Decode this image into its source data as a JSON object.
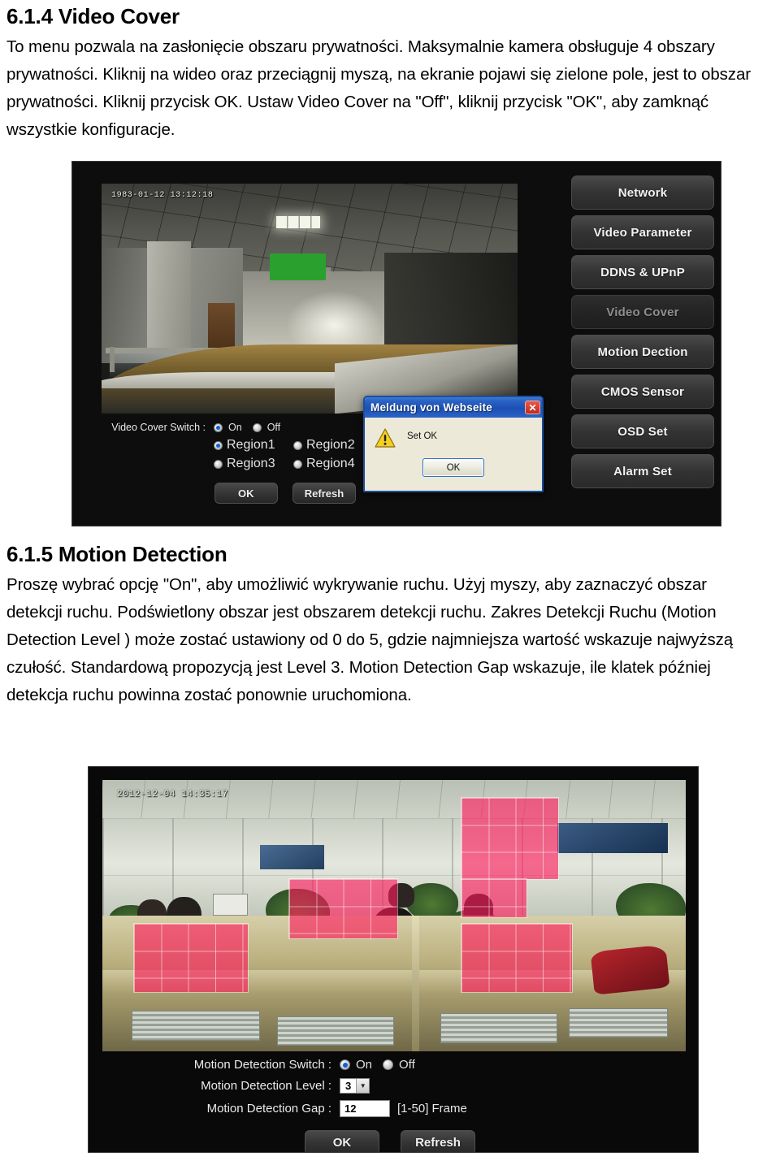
{
  "section1": {
    "heading": "6.1.4 Video Cover",
    "paragraphs": [
      "To menu pozwala na zasłonięcie obszaru prywatności. Maksymalnie kamera obsługuje 4 obszary prywatności. Kliknij na wideo oraz przeciągnij myszą, na ekranie pojawi się zielone pole, jest to obszar prywatności. Kliknij przycisk OK. Ustaw Video Cover na \"Off\", kliknij przycisk \"OK\", aby zamknąć wszystkie konfiguracje."
    ]
  },
  "section2": {
    "heading": "6.1.5 Motion Detection",
    "paragraphs": [
      "Proszę wybrać opcję \"On\", aby umożliwić wykrywanie ruchu. Użyj myszy, aby zaznaczyć obszar detekcji ruchu. Podświetlony obszar jest obszarem detekcji ruchu. Zakres Detekcji Ruchu (Motion Detection Level ) może zostać ustawiony od 0 do 5, gdzie najmniejsza wartość wskazuje najwyższą czułość. Standardową propozycją jest Level 3. Motion Detection Gap wskazuje, ile klatek później detekcja ruchu powinna zostać ponownie uruchomiona."
    ]
  },
  "screenshot1": {
    "timestamp": "1983-01-12 13:12:18",
    "dialog": {
      "title": "Meldung von Webseite",
      "close_label": "✕",
      "message": "Set OK",
      "ok_label": "OK",
      "warning_icon": "warning-triangle-icon"
    },
    "menu": [
      {
        "label": "Network",
        "active": false
      },
      {
        "label": "Video Parameter",
        "active": false
      },
      {
        "label": "DDNS & UPnP",
        "active": false
      },
      {
        "label": "Video Cover",
        "active": true
      },
      {
        "label": "Motion Dection",
        "active": false
      },
      {
        "label": "CMOS Sensor",
        "active": false
      },
      {
        "label": "OSD Set",
        "active": false
      },
      {
        "label": "Alarm Set",
        "active": false
      }
    ],
    "controls": {
      "switch_label": "Video Cover Switch :",
      "on_label": "On",
      "off_label": "Off",
      "switch_value": "On",
      "regions": [
        {
          "label": "Region1",
          "selected": true
        },
        {
          "label": "Region2",
          "selected": false
        },
        {
          "label": "Region3",
          "selected": false
        },
        {
          "label": "Region4",
          "selected": false
        }
      ],
      "ok_label": "OK",
      "refresh_label": "Refresh"
    },
    "cover_box_color": "#2aa02f"
  },
  "screenshot2": {
    "timestamp": "2012-12-04 14:35:17",
    "controls": {
      "switch_label": "Motion Detection Switch :",
      "on_label": "On",
      "off_label": "Off",
      "switch_value": "On",
      "level_label": "Motion Detection Level :",
      "level_value": "3",
      "level_arrow": "▼",
      "gap_label": "Motion Detection Gap :",
      "gap_value": "12",
      "gap_hint": "[1-50] Frame",
      "ok_label": "OK",
      "refresh_label": "Refresh"
    },
    "detection_color": "#ff1a5c"
  }
}
